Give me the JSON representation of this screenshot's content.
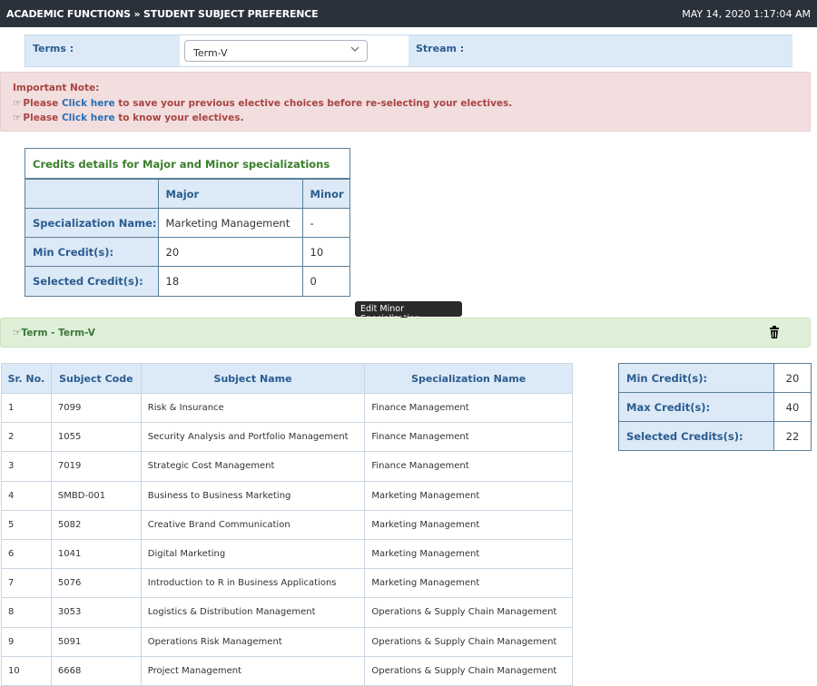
{
  "header": {
    "breadcrumb": "ACADEMIC FUNCTIONS » STUDENT SUBJECT PREFERENCE",
    "datetime": "MAY 14, 2020  1:17:04 AM"
  },
  "terms_row": {
    "terms_label": "Terms :",
    "terms_value": "Term-V",
    "stream_label": "Stream :"
  },
  "note": {
    "title": "Important Note:",
    "line1_prefix": "Please ",
    "line1_link": "Click here",
    "line1_suffix": " to save your previous elective choices before re-selecting your electives.",
    "line2_prefix": "Please ",
    "line2_link": "Click here",
    "line2_suffix": " to know your electives."
  },
  "credits_details": {
    "caption": "Credits details for Major and Minor specializations",
    "col_major": "Major",
    "col_minor": "Minor",
    "rows": [
      {
        "label": "Specialization Name:",
        "major": "Marketing Management",
        "minor": "-"
      },
      {
        "label": "Min Credit(s):",
        "major": "20",
        "minor": "10"
      },
      {
        "label": "Selected Credit(s):",
        "major": "18",
        "minor": "0"
      }
    ]
  },
  "tooltip": "Edit Minor Specialization",
  "term_bar": {
    "label": "Term - Term-V"
  },
  "subjects": {
    "headers": [
      "Sr. No.",
      "Subject Code",
      "Subject Name",
      "Specialization Name"
    ],
    "rows": [
      [
        "1",
        "7099",
        "Risk & Insurance",
        "Finance Management"
      ],
      [
        "2",
        "1055",
        "Security Analysis and Portfolio Management",
        "Finance Management"
      ],
      [
        "3",
        "7019",
        "Strategic Cost Management",
        "Finance Management"
      ],
      [
        "4",
        "SMBD-001",
        "Business to Business Marketing",
        "Marketing Management"
      ],
      [
        "5",
        "5082",
        "Creative Brand Communication",
        "Marketing Management"
      ],
      [
        "6",
        "1041",
        "Digital Marketing",
        "Marketing Management"
      ],
      [
        "7",
        "5076",
        "Introduction to R in Business Applications",
        "Marketing Management"
      ],
      [
        "8",
        "3053",
        "Logistics & Distribution Management",
        "Operations & Supply Chain Management"
      ],
      [
        "9",
        "5091",
        "Operations Risk Management",
        "Operations & Supply Chain Management"
      ],
      [
        "10",
        "6668",
        "Project Management",
        "Operations & Supply Chain Management"
      ]
    ]
  },
  "summary": [
    {
      "label": "Min Credit(s):",
      "value": "20"
    },
    {
      "label": "Max Credit(s):",
      "value": "40"
    },
    {
      "label": "Selected Credits(s):",
      "value": "22"
    }
  ],
  "icons": {
    "pointing_hand": "☞",
    "dropdown": "chevron-down-icon",
    "delete": "trash-icon"
  }
}
